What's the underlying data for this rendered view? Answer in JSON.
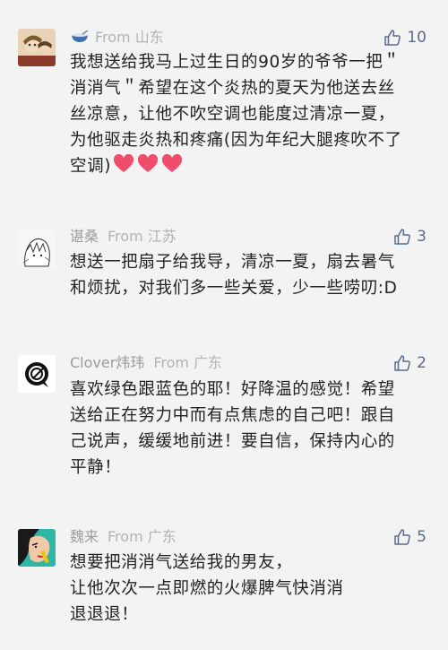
{
  "comments": [
    {
      "name": "",
      "from": "From 山东",
      "likes": "10",
      "lines": [
        "我想送给我马上过生日的90岁的爷爷一把＂",
        "消消气＂希望在这个炎热的夏天为他送去丝",
        "丝凉意，让他不吹空调也能度过清凉一夏，",
        "为他驱走炎热和疼痛(因为年纪大腿疼吹不了",
        "空调)"
      ]
    },
    {
      "name": "谌桑",
      "from": "From 江苏",
      "likes": "3",
      "lines": [
        "想送一把扇子给我导，清凉一夏，扇去暑气",
        "和烦扰，对我们多一些关爱，少一些唠叨:D"
      ]
    },
    {
      "name": "Clover炜玮",
      "from": "From 广东",
      "likes": "2",
      "lines": [
        "喜欢绿色跟蓝色的耶！好降温的感觉！希望",
        "送给正在努力中而有点焦虑的自己吧！跟自",
        "己说声，缓缓地前进！要自信，保持内心的",
        "平静！"
      ]
    },
    {
      "name": "魏来",
      "from": "From 广东",
      "likes": "5",
      "lines": [
        "想要把消消气送给我的男友，",
        "让他次次一点即燃的火爆脾气快消消",
        "退退退！"
      ]
    }
  ],
  "colors": {
    "background": "#f3f3f3",
    "text": "#222222",
    "meta": "#a0a3a8",
    "like": "#5a6b8a",
    "heart": "#ee4d6b"
  },
  "icons": {
    "like": "thumbs-up-icon",
    "heart": "heart-emoji-icon",
    "nickname": "bowl-emoji-icon"
  }
}
